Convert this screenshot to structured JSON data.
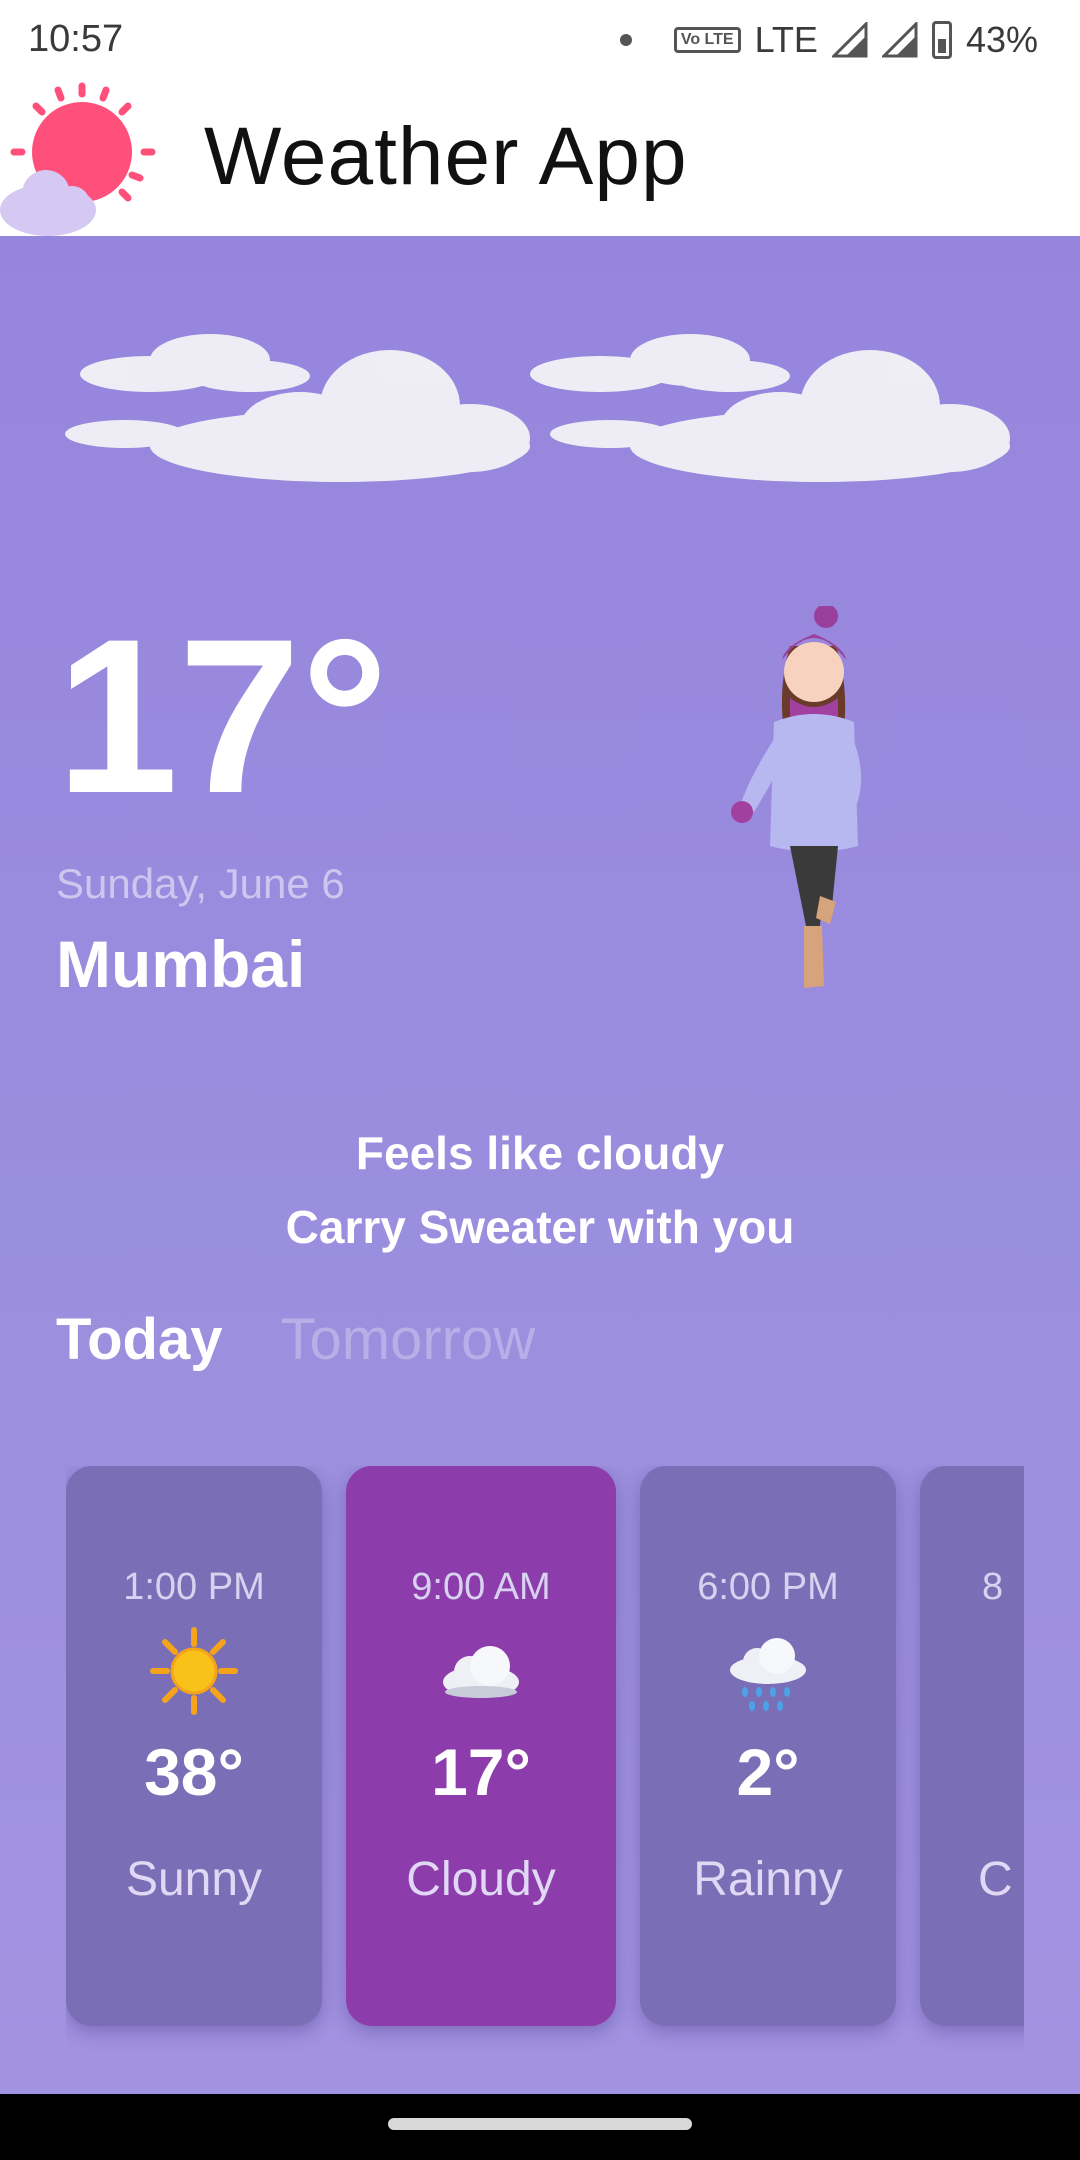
{
  "status_bar": {
    "time": "10:57",
    "network": "LTE",
    "volte_label": "Vo LTE",
    "battery": "43%"
  },
  "app_bar": {
    "title": "Weather App",
    "logo_icon": "sun-cloud-icon"
  },
  "current": {
    "temperature": "17°",
    "date": "Sunday, June 6",
    "city": "Mumbai",
    "advice_line1": "Feels like cloudy",
    "advice_line2": "Carry Sweater with you"
  },
  "tabs": [
    {
      "label": "Today",
      "active": true
    },
    {
      "label": "Tomorrow",
      "active": false
    }
  ],
  "forecast": [
    {
      "time": "1:00 PM",
      "icon": "sun-icon",
      "temp": "38°",
      "condition": "Sunny"
    },
    {
      "time": "9:00 AM",
      "icon": "cloud-icon",
      "temp": "17°",
      "condition": "Cloudy"
    },
    {
      "time": "6:00 PM",
      "icon": "rain-cloud-icon",
      "temp": "2°",
      "condition": "Rainny"
    },
    {
      "time": "8",
      "icon": "",
      "temp": "",
      "condition": "C"
    }
  ],
  "colors": {
    "background": "#9685dd",
    "card": "#7a6fb6",
    "card_selected": "#8c3dab",
    "sun": "#ff4f7b"
  }
}
